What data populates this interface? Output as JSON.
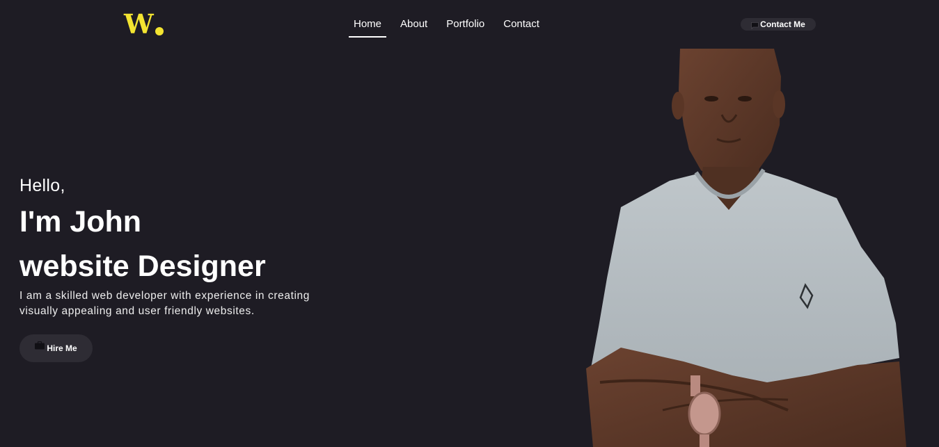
{
  "header": {
    "logo": {
      "letter": "W"
    },
    "nav": [
      {
        "label": "Home",
        "active": true
      },
      {
        "label": "About",
        "active": false
      },
      {
        "label": "Portfolio",
        "active": false
      },
      {
        "label": "Contact",
        "active": false
      }
    ],
    "contact_button": {
      "label": "Contact Me",
      "icon": "chat-icon"
    }
  },
  "hero": {
    "greeting": "Hello,",
    "name_line": "I'm John",
    "role_line": "website Designer",
    "description": "I am a skilled web developer with experience in creating visually appealing and user friendly websites.",
    "hire_button": {
      "label": "Hire Me",
      "icon": "briefcase-icon"
    },
    "portrait": {
      "subject": "portrait-photo"
    }
  },
  "colors": {
    "background": "#1e1c24",
    "accent": "#f3e431",
    "button_bg": "#2e2c34",
    "text": "#ffffff"
  }
}
